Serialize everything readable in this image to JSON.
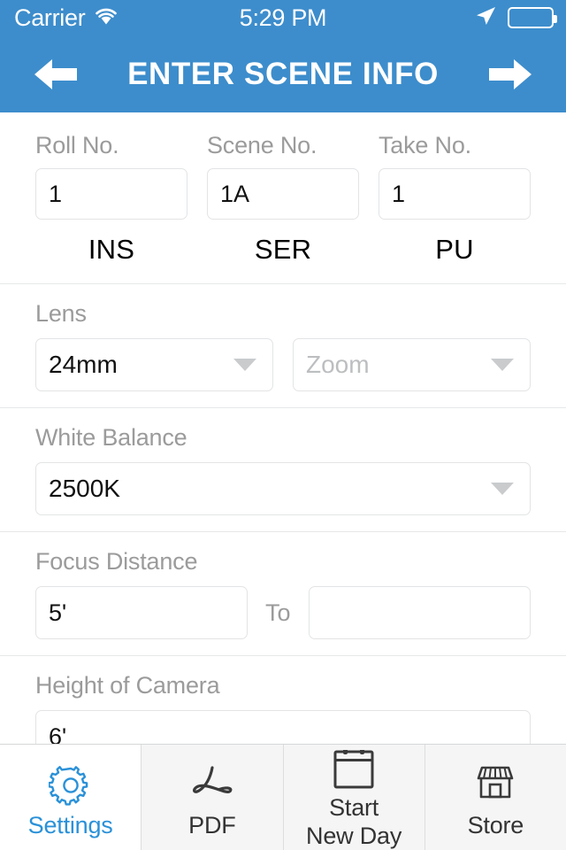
{
  "status_bar": {
    "carrier": "Carrier",
    "time": "5:29 PM",
    "wifi_icon": "wifi-icon",
    "location_icon": "location-arrow-icon",
    "battery_icon": "battery-icon"
  },
  "nav": {
    "title": "ENTER SCENE INFO",
    "back_icon": "arrow-left-icon",
    "forward_icon": "arrow-right-icon"
  },
  "theme": {
    "accent": "#3d8dcc",
    "tab_active": "#2a91d8",
    "label_grey": "#9b9b9b",
    "border_grey": "#e3e4e5"
  },
  "form": {
    "scene_row": {
      "fields": [
        {
          "label": "Roll No.",
          "value": "1",
          "abbr": "INS"
        },
        {
          "label": "Scene No.",
          "value": "1A",
          "abbr": "SER"
        },
        {
          "label": "Take No.",
          "value": "1",
          "abbr": "PU"
        }
      ]
    },
    "lens": {
      "label": "Lens",
      "focal_value": "24mm",
      "zoom_placeholder": "Zoom",
      "zoom_value": ""
    },
    "white_balance": {
      "label": "White Balance",
      "value": "2500K"
    },
    "focus_distance": {
      "label": "Focus Distance",
      "from_value": "5'",
      "to_label": "To",
      "to_value": ""
    },
    "height_of_camera": {
      "label": "Height of Camera",
      "value": "6'"
    }
  },
  "tabbar": {
    "items": [
      {
        "label": "Settings",
        "icon": "gear-icon",
        "active": true
      },
      {
        "label": "PDF",
        "icon": "pdf-acrobat-icon",
        "active": false
      },
      {
        "label": "Start\nNew Day",
        "label_line1": "Start",
        "label_line2": "New Day",
        "icon": "calendar-icon",
        "active": false
      },
      {
        "label": "Store",
        "icon": "storefront-icon",
        "active": false
      }
    ]
  }
}
